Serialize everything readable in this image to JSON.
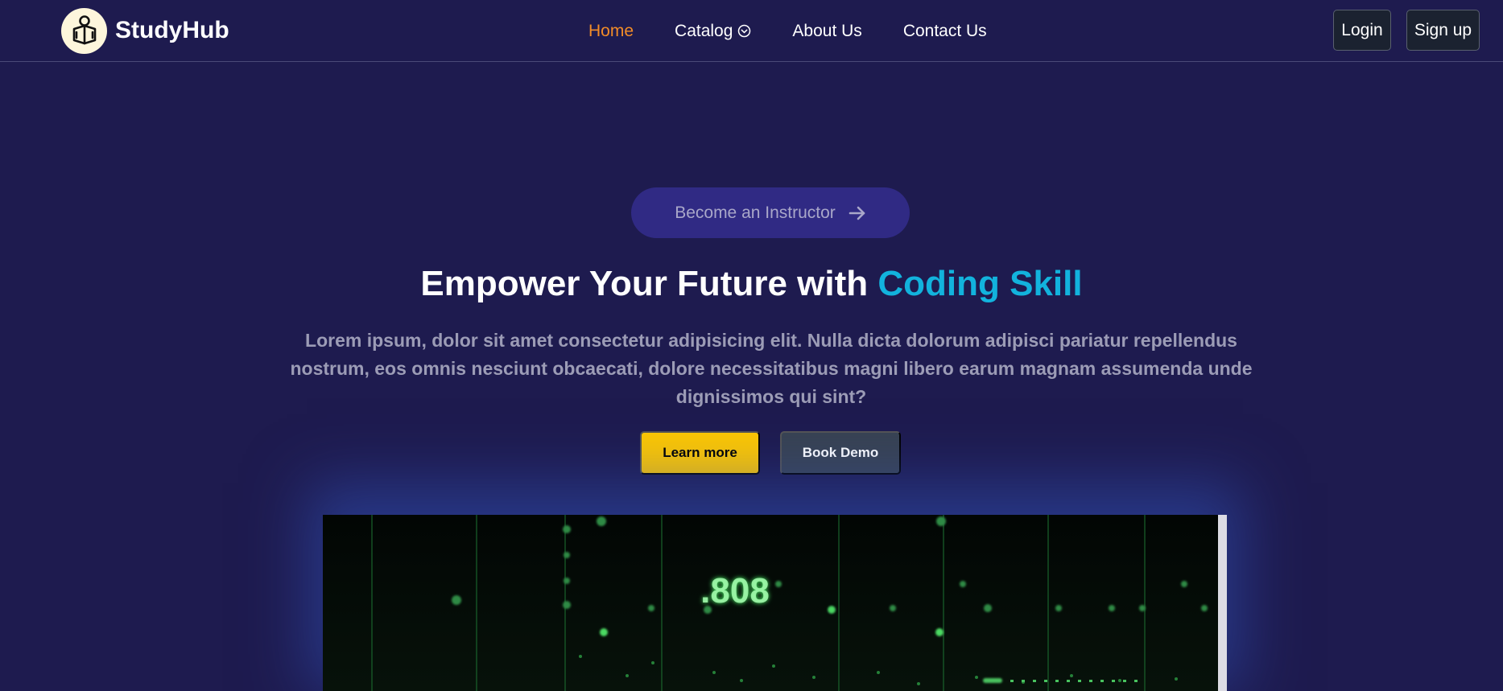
{
  "brand": {
    "name": "StudyHub",
    "logo_icon": "reading-person-icon"
  },
  "nav": {
    "links": [
      {
        "label": "Home",
        "active": true
      },
      {
        "label": "Catalog",
        "active": false,
        "icon": "chevron-down-circle-icon"
      },
      {
        "label": "About Us",
        "active": false
      },
      {
        "label": "Contact Us",
        "active": false
      }
    ],
    "active_color": "#f28c28"
  },
  "auth": {
    "login_label": "Login",
    "signup_label": "Sign up"
  },
  "hero": {
    "instructor_label": "Become an Instructor",
    "instructor_icon": "arrow-right-icon",
    "headline_prefix": "Empower Your Future with ",
    "headline_accent": "Coding Skill",
    "accent_color": "#12b3dd",
    "description": "Lorem ipsum, dolor sit amet consectetur adipisicing elit. Nulla dicta dolorum adipisci pariatur repellendus nostrum, eos omnis nesciunt obcaecati, dolore necessitatibus magni libero earum magnam assumenda unde dignissimos qui sint?",
    "learn_more_label": "Learn more",
    "book_demo_label": "Book Demo"
  },
  "video": {
    "display_text": ".808"
  },
  "colors": {
    "background": "#1e1b4f",
    "learn_more": "#fdc702",
    "book_demo": "#384252"
  }
}
